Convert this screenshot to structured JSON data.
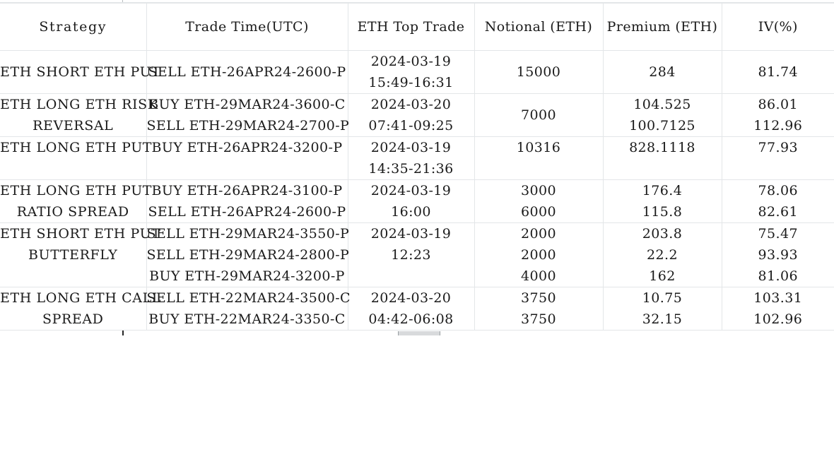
{
  "table": {
    "columns": [
      {
        "key": "strategy",
        "label": "Strategy"
      },
      {
        "key": "top_trade",
        "label": "Trade Time(UTC)"
      },
      {
        "key": "trade_time",
        "label": "ETH Top Trade"
      },
      {
        "key": "notional",
        "label": "Notional (ETH)"
      },
      {
        "key": "premium",
        "label": "Premium (ETH)"
      },
      {
        "key": "iv",
        "label": "IV(%)"
      }
    ],
    "rows": [
      {
        "strategy": [
          "ETH SHORT ETH PUT"
        ],
        "top_trade": [
          "SELL ETH-26APR24-2600-P"
        ],
        "trade_time": [
          "2024-03-19",
          "15:49-16:31"
        ],
        "notional": [
          "15000"
        ],
        "premium": [
          "284"
        ],
        "iv": [
          "81.74"
        ],
        "align": "middle"
      },
      {
        "strategy": [
          "ETH LONG ETH RISK",
          "REVERSAL"
        ],
        "top_trade": [
          "BUY ETH-29MAR24-3600-C",
          "SELL ETH-29MAR24-2700-P"
        ],
        "trade_time": [
          "2024-03-20",
          "07:41-09:25"
        ],
        "notional": [
          "7000"
        ],
        "premium": [
          "104.525",
          "100.7125"
        ],
        "iv": [
          "86.01",
          "112.96"
        ],
        "align": "middle"
      },
      {
        "strategy": [
          "ETH LONG ETH PUT"
        ],
        "top_trade": [
          "BUY ETH-26APR24-3200-P"
        ],
        "trade_time": [
          "2024-03-19",
          "14:35-21:36"
        ],
        "notional": [
          "10316"
        ],
        "premium": [
          "828.1118"
        ],
        "iv": [
          "77.93"
        ],
        "align": "top"
      },
      {
        "strategy": [
          "ETH LONG ETH PUT",
          "RATIO SPREAD"
        ],
        "top_trade": [
          "BUY ETH-26APR24-3100-P",
          "SELL ETH-26APR24-2600-P"
        ],
        "trade_time": [
          "2024-03-19",
          "16:00"
        ],
        "notional": [
          "3000",
          "6000"
        ],
        "premium": [
          "176.4",
          "115.8"
        ],
        "iv": [
          "78.06",
          "82.61"
        ],
        "align": "top"
      },
      {
        "strategy": [
          "ETH SHORT ETH PUT",
          "BUTTERFLY"
        ],
        "top_trade": [
          "SELL ETH-29MAR24-3550-P",
          "SELL ETH-29MAR24-2800-P",
          "BUY ETH-29MAR24-3200-P"
        ],
        "trade_time": [
          "2024-03-19",
          "12:23"
        ],
        "notional": [
          "2000",
          "2000",
          "4000"
        ],
        "premium": [
          "203.8",
          "22.2",
          "162"
        ],
        "iv": [
          "75.47",
          "93.93",
          "81.06"
        ],
        "align": "top"
      },
      {
        "strategy": [
          "ETH LONG ETH CALL",
          "SPREAD"
        ],
        "top_trade": [
          "SELL ETH-22MAR24-3500-C",
          "BUY ETH-22MAR24-3350-C"
        ],
        "trade_time": [
          "2024-03-20",
          "04:42-06:08"
        ],
        "notional": [
          "3750",
          "3750"
        ],
        "premium": [
          "10.75",
          "32.15"
        ],
        "iv": [
          "103.31",
          "102.96"
        ],
        "align": "top"
      }
    ]
  },
  "colors": {
    "text": "#1a1a1a",
    "grid_line": "#e3e6e8",
    "background": "#ffffff"
  }
}
